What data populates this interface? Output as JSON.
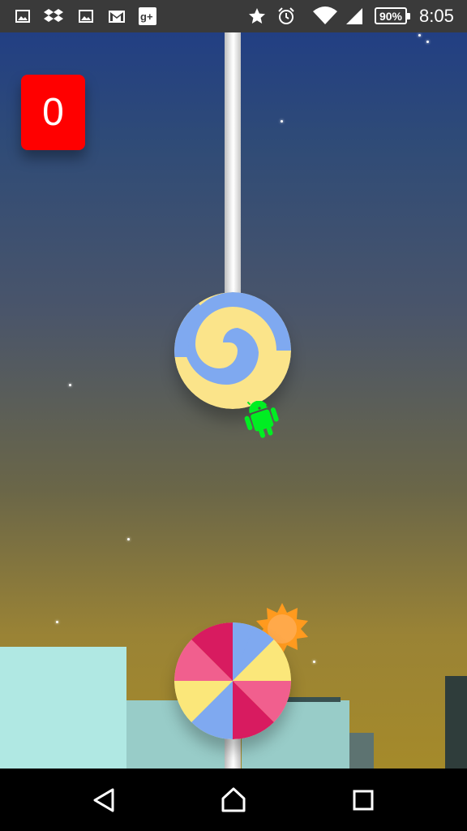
{
  "status_bar": {
    "left_icons": [
      "image-icon",
      "dropbox-icon",
      "image-icon",
      "gmail-icon",
      "google-plus-icon"
    ],
    "right_icons": [
      "star-icon",
      "alarm-icon",
      "wifi-icon",
      "signal-icon"
    ],
    "battery": "90%",
    "time": "8:05"
  },
  "game": {
    "score": "0",
    "colors": {
      "sky_top": "#223f83",
      "sky_bottom": "#a58a2a",
      "score_bg": "#ff0000",
      "android": "#00ee22",
      "sun": "#ff9a1e",
      "building_light": "#b0e8e3",
      "building_mid": "#98ccc8"
    },
    "obstacles": [
      "swirl-lollipop",
      "pinwheel-lollipop"
    ]
  },
  "nav_bar": {
    "buttons": [
      "back-icon",
      "home-icon",
      "recents-icon"
    ]
  }
}
